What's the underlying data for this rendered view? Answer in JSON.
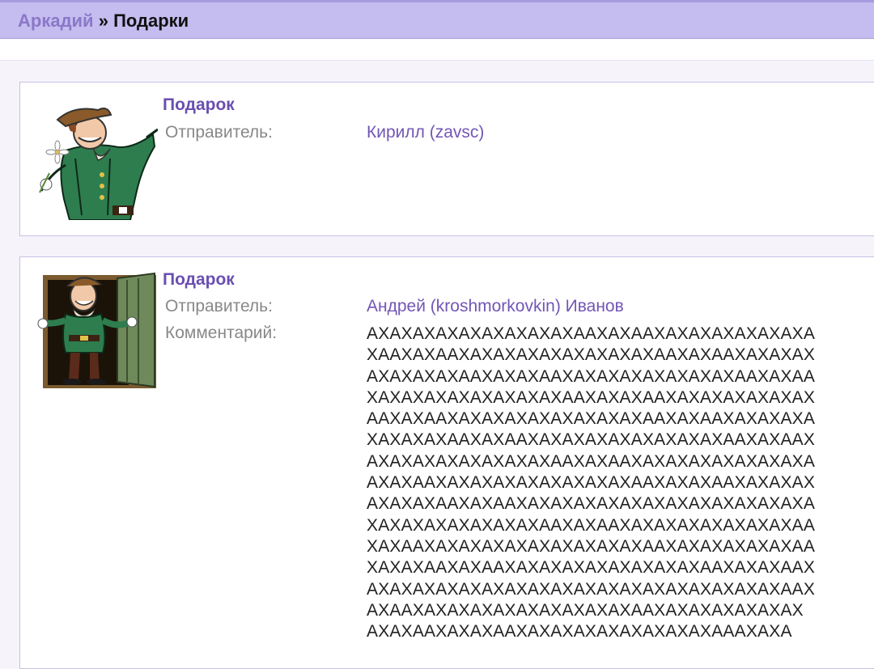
{
  "header": {
    "breadcrumb_link": "Аркадий",
    "separator": " » ",
    "current": "Подарки"
  },
  "gifts": [
    {
      "title": "Подарок",
      "sender_label": "Отправитель:",
      "sender": "Кирилл (zavsc)",
      "image": "cartoon-squire-with-flower"
    },
    {
      "title": "Подарок",
      "sender_label": "Отправитель:",
      "sender": "Андрей (kroshmorkovkin) Иванов",
      "comment_label": "Комментарий:",
      "comment": "АХАХАХАХАХАХАХАХАХААХАХААХАХАХАХАХАХАХА\nХААХАХААХАХАХАХАХАХАХАХАХААХАХААХАХАХАХ\nАХАХАХАХААХАХАХААХАХАХАХАХАХАХАХААХАХАА\nХАХАХАХАХАХАХАХАХААХАХАХААХАХАХАХАХАХАХ\nААХАХААХАХАХАХАХАХАХАХАХААХАХААХАХАХАХА\nХАХАХАХААХАХААХАХАХАХАХАХАХАХАХААХАХААХ\nАХАХАХАХАХАХАХАХААХАХААХАХАХАХАХАХАХАХА\nАХАХААХАХАХАХАХАХАХАХАХААХАХАХААХАХАХАХ\nАХАХАХААХАХААХАХАХАХАХАХАХАХАХАХАХАХАХА\nХАХАХАХАХАХАХАХААХАХААХАХАХАХАХАХАХАХАА\nХАХААХАХАХАХАХАХАХАХАХАХААХАХАХАХАХАХАА\nХАХАХААХАХААХАХАХАХАХАХАХАХАХААХАХАХААХ\nАХАХАХАХАХАХАХАХАХАХАХАХАХАХАХАХАХАХААХ\nАХААХАХАХАХАХАХАХАХАХАХААХАХАХАХАХАХАХ\nАХАХААХАХАХААХАХАХАХАХАХАХАХАХАААХАХА",
      "image": "cartoon-squire-at-door"
    }
  ],
  "colors": {
    "topbar": "#c5bcef",
    "link": "#8a78c8",
    "accent": "#6a4fb0",
    "label": "#888888"
  }
}
